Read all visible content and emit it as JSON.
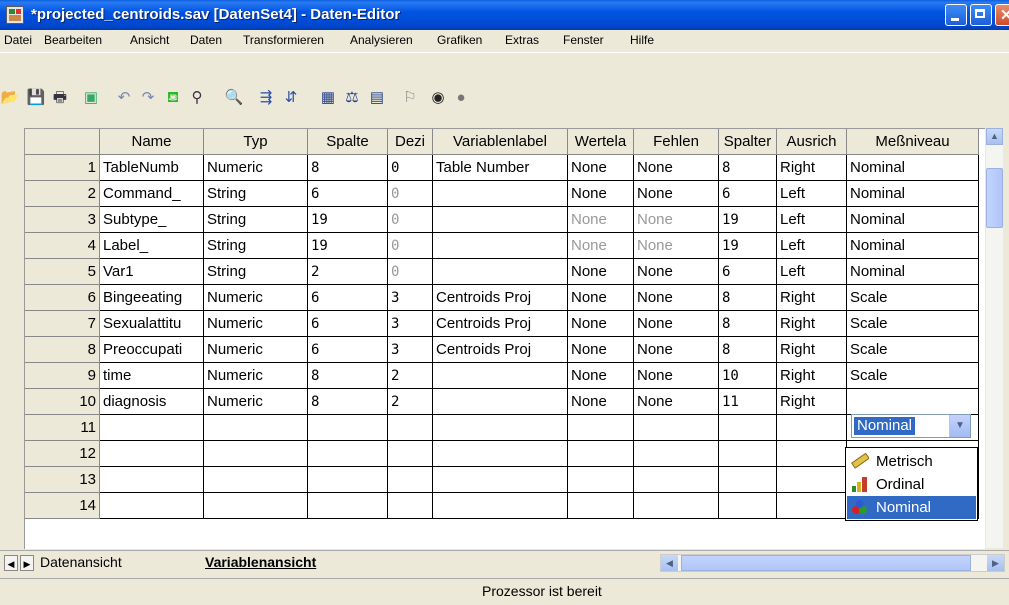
{
  "window": {
    "title": "*projected_centroids.sav [DatenSet4] - Daten-Editor"
  },
  "menu": [
    "Datei",
    "Bearbeiten",
    "Ansicht",
    "Daten",
    "Transformieren",
    "Analysieren",
    "Grafiken",
    "Extras",
    "Fenster",
    "Hilfe"
  ],
  "toolbar_icons": [
    "open-icon",
    "save-icon",
    "print-icon",
    "dialog-recall-icon",
    "undo-icon",
    "redo-icon",
    "goto-case-icon",
    "variables-icon",
    "find-icon",
    "insert-cases-icon",
    "insert-variable-icon",
    "split-file-icon",
    "weight-cases-icon",
    "select-cases-icon",
    "value-labels-icon",
    "use-sets-icon",
    "show-all-icon"
  ],
  "columns": [
    "Name",
    "Typ",
    "Spalte",
    "Dezi",
    "Variablenlabel",
    "Wertela",
    "Fehlen",
    "Spalter",
    "Ausrich",
    "Meßniveau"
  ],
  "rows": [
    {
      "num": "1",
      "name": "TableNumb",
      "typ": "Numeric",
      "spalte": "8",
      "dezi": "0",
      "label": "Table Number",
      "werte": "None",
      "fehlen": "None",
      "spalten": "8",
      "ausrich": "Right",
      "mess": "Nominal"
    },
    {
      "num": "2",
      "name": "Command_",
      "typ": "String",
      "spalte": "6",
      "dezi": "0",
      "label": "",
      "werte": "None",
      "fehlen": "None",
      "spalten": "6",
      "ausrich": "Left",
      "mess": "Nominal"
    },
    {
      "num": "3",
      "name": "Subtype_",
      "typ": "String",
      "spalte": "19",
      "dezi": "0",
      "label": "",
      "werte": "None",
      "fehlen": "None",
      "spalten": "19",
      "ausrich": "Left",
      "mess": "Nominal"
    },
    {
      "num": "4",
      "name": "Label_",
      "typ": "String",
      "spalte": "19",
      "dezi": "0",
      "label": "",
      "werte": "None",
      "fehlen": "None",
      "spalten": "19",
      "ausrich": "Left",
      "mess": "Nominal"
    },
    {
      "num": "5",
      "name": "Var1",
      "typ": "String",
      "spalte": "2",
      "dezi": "0",
      "label": "",
      "werte": "None",
      "fehlen": "None",
      "spalten": "6",
      "ausrich": "Left",
      "mess": "Nominal"
    },
    {
      "num": "6",
      "name": "Bingeeating",
      "typ": "Numeric",
      "spalte": "6",
      "dezi": "3",
      "label": "Centroids Proj",
      "werte": "None",
      "fehlen": "None",
      "spalten": "8",
      "ausrich": "Right",
      "mess": "Scale"
    },
    {
      "num": "7",
      "name": "Sexualattitu",
      "typ": "Numeric",
      "spalte": "6",
      "dezi": "3",
      "label": "Centroids Proj",
      "werte": "None",
      "fehlen": "None",
      "spalten": "8",
      "ausrich": "Right",
      "mess": "Scale"
    },
    {
      "num": "8",
      "name": "Preoccupati",
      "typ": "Numeric",
      "spalte": "6",
      "dezi": "3",
      "label": "Centroids Proj",
      "werte": "None",
      "fehlen": "None",
      "spalten": "8",
      "ausrich": "Right",
      "mess": "Scale"
    },
    {
      "num": "9",
      "name": "time",
      "typ": "Numeric",
      "spalte": "8",
      "dezi": "2",
      "label": "",
      "werte": "None",
      "fehlen": "None",
      "spalten": "10",
      "ausrich": "Right",
      "mess": "Scale"
    },
    {
      "num": "10",
      "name": "diagnosis",
      "typ": "Numeric",
      "spalte": "8",
      "dezi": "2",
      "label": "",
      "werte": "None",
      "fehlen": "None",
      "spalten": "11",
      "ausrich": "Right",
      "mess": ""
    },
    {
      "num": "11"
    },
    {
      "num": "12"
    },
    {
      "num": "13"
    },
    {
      "num": "14"
    }
  ],
  "dropdown": {
    "value": "Nominal",
    "options": [
      "Metrisch",
      "Ordinal",
      "Nominal"
    ],
    "selected": "Nominal"
  },
  "tabs": {
    "data_view": "Datenansicht",
    "variable_view": "Variablenansicht"
  },
  "status": "Prozessor ist bereit"
}
